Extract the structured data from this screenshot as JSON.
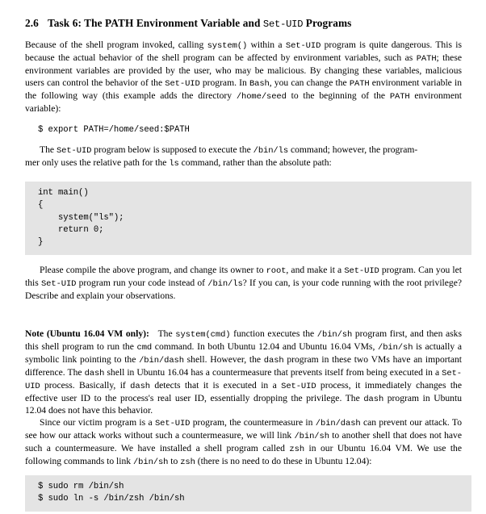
{
  "document": {
    "heading": {
      "number": "2.6",
      "text_before_mono": "Task 6: The PATH Environment Variable and ",
      "mono": "Set-UID",
      "text_after_mono": " Programs",
      "full": "2.6  Task 6: The PATH Environment Variable and Set-UID Programs"
    },
    "paragraphs": {
      "intro": "Because of the shell program invoked, calling system() within a Set-UID program is quite dangerous. This is because the actual behavior of the shell program can be affected by environment variables, such as PATH; these environment variables are provided by the user, who may be malicious. By changing these variables, malicious users can control the behavior of the Set-UID program. In Bash, you can change the PATH environment variable in the following way (this example adds the directory /home/seed to the beginning of the PATH environment variable):",
      "setuid_below": "The Set-UID program below is supposed to execute the /bin/ls command; however, the programmer only uses the relative path for the ls command, rather than the absolute path:",
      "compile": "Please compile the above program, and change its owner to root, and make it a Set-UID program. Can you let this Set-UID program run your code instead of /bin/ls? If you can, is your code running with the root privilege? Describe and explain your observations.",
      "note_label": "Note (Ubuntu 16.04 VM only):",
      "note_body": "The system(cmd) function executes the /bin/sh program first, and then asks this shell program to run the cmd command. In both Ubuntu 12.04 and Ubuntu 16.04 VMs, /bin/sh is actually a symbolic link pointing to the /bin/dash shell. However, the dash program in these two VMs have an important difference. The dash shell in Ubuntu 16.04 has a countermeasure that prevents itself from being executed in a Set-UID process. Basically, if dash detects that it is executed in a Set-UID process, it immediately changes the effective user ID to the process's real user ID, essentially dropping the privilege. The dash program in Ubuntu 12.04 does not have this behavior.",
      "countermeasure": "Since our victim program is a Set-UID program, the countermeasure in /bin/dash can prevent our attack. To see how our attack works without such a countermeasure, we will link /bin/sh to another shell that does not have such a countermeasure. We have installed a shell program called zsh in our Ubuntu 16.04 VM. We use the following commands to link /bin/sh to zsh (there is no need to do these in Ubuntu 12.04):"
    },
    "code_blocks": {
      "export_path": {
        "lines": [
          "$ export PATH=/home/seed:$PATH"
        ],
        "shaded": false
      },
      "c_program": {
        "lines": [
          "int main()",
          "{",
          "    system(\"ls\");",
          "    return 0;",
          "}"
        ],
        "shaded": true
      },
      "link_shell": {
        "lines": [
          "$ sudo rm /bin/sh",
          "$ sudo ln -s /bin/zsh /bin/sh"
        ],
        "shaded": true
      }
    },
    "colors": {
      "page_background": "#ffffff",
      "code_background": "#e4e4e4",
      "text": "#000000"
    }
  }
}
